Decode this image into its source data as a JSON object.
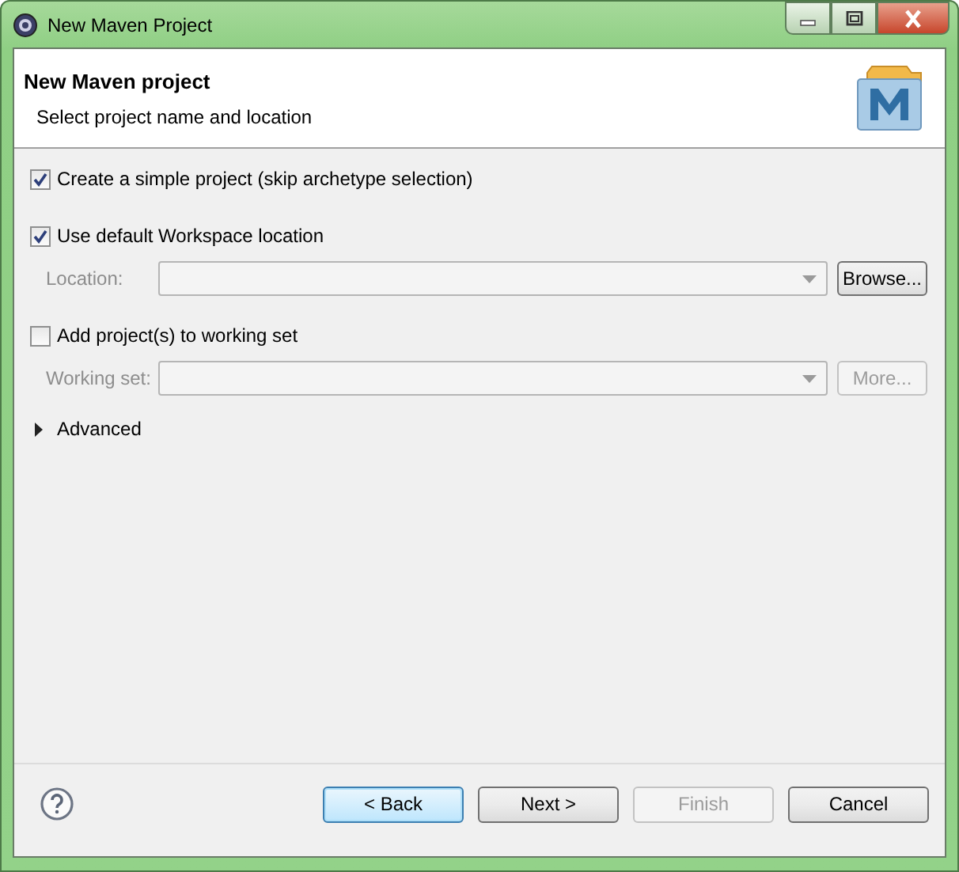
{
  "window": {
    "title": "New Maven Project"
  },
  "header": {
    "title": "New Maven project",
    "subtitle": "Select project name and location"
  },
  "options": [
    {
      "kind": "checkbox",
      "label": "Create a simple project (skip archetype selection)",
      "checked": true
    },
    {
      "kind": "checkbox",
      "label": "Use default Workspace location",
      "checked": true
    },
    {
      "kind": "combo",
      "label": "Location:",
      "disabled": true,
      "button": {
        "label": "Browse...",
        "disabled": false
      }
    },
    {
      "kind": "checkbox",
      "label": "Add project(s) to working set",
      "checked": false
    },
    {
      "kind": "combo",
      "label": "Working set:",
      "disabled": true,
      "button": {
        "label": "More...",
        "disabled": true
      }
    },
    {
      "kind": "expander",
      "label": "Advanced",
      "expanded": false
    }
  ],
  "buttons": [
    {
      "label": "< Back",
      "disabled": false,
      "default": true
    },
    {
      "label": "Next >",
      "disabled": false,
      "default": false
    },
    {
      "label": "Finish",
      "disabled": true,
      "default": false
    },
    {
      "label": "Cancel",
      "disabled": false,
      "default": false
    }
  ]
}
